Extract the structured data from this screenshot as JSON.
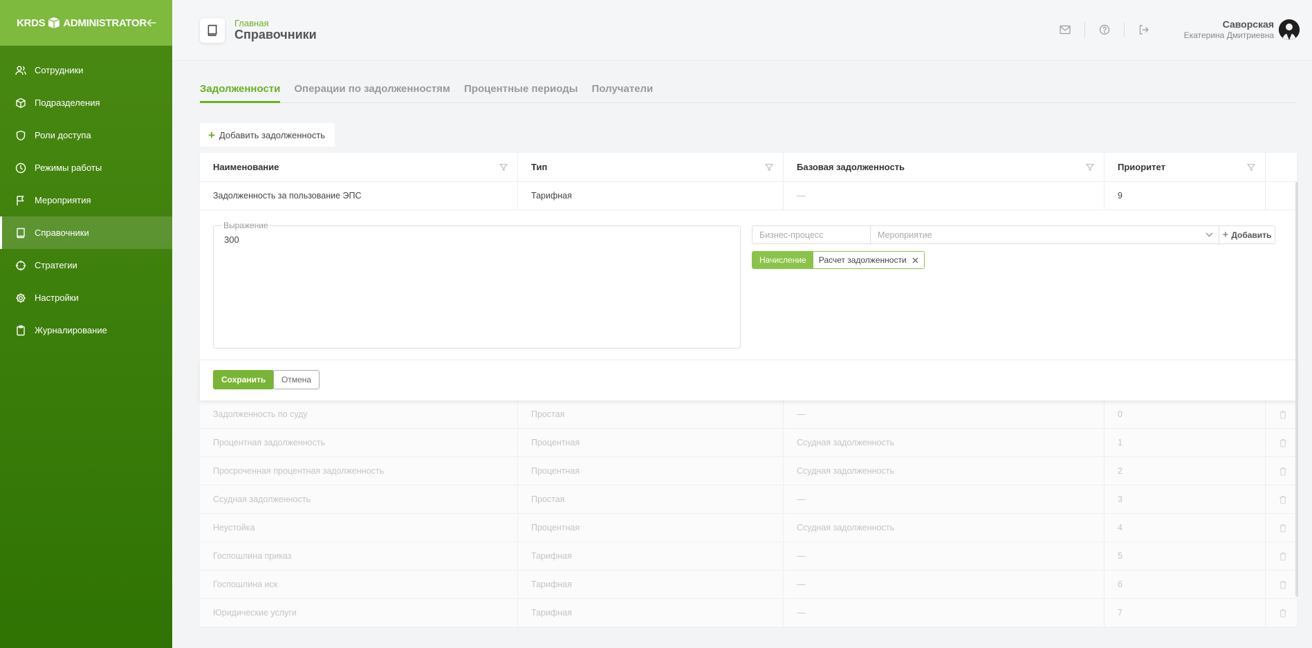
{
  "app": {
    "logo_left": "KRDS",
    "logo_right": "ADMINISTRATOR"
  },
  "sidebar": {
    "items": [
      {
        "label": "Сотрудники",
        "icon": "users-icon"
      },
      {
        "label": "Подразделения",
        "icon": "cube-icon"
      },
      {
        "label": "Роли доступа",
        "icon": "shield-icon"
      },
      {
        "label": "Режимы работы",
        "icon": "clock-icon"
      },
      {
        "label": "Мероприятия",
        "icon": "flag-icon"
      },
      {
        "label": "Справочники",
        "icon": "book-icon",
        "active": true
      },
      {
        "label": "Стратегии",
        "icon": "crosshair-icon"
      },
      {
        "label": "Настройки",
        "icon": "gear-icon"
      },
      {
        "label": "Журналирование",
        "icon": "clipboard-icon"
      }
    ]
  },
  "header": {
    "breadcrumb": "Главная",
    "title": "Справочники",
    "user_last": "Саворская",
    "user_first": "Екатерина Дмитриевна"
  },
  "tabs": [
    "Задолженности",
    "Операции по задолженностям",
    "Процентные периоды",
    "Получатели"
  ],
  "toolbar": {
    "add_label": "Добавить задолженность"
  },
  "table": {
    "columns": [
      "Наименование",
      "Тип",
      "Базовая задолженность",
      "Приоритет"
    ],
    "selected": {
      "name": "Задолженность за пользование ЭПС",
      "type": "Тарифная",
      "base": "—",
      "priority": "9"
    },
    "editor": {
      "expr_label": "Выражение",
      "expr_value": "300",
      "process_placeholder": "Бизнес-процесс",
      "event_placeholder": "Мероприятие",
      "add_label": "Добавить",
      "tag_type": "Начисление",
      "tag_name": "Расчет задолженности",
      "save_label": "Сохранить",
      "cancel_label": "Отмена"
    },
    "rows": [
      {
        "name": "Задолженность по суду",
        "type": "Простая",
        "base": "—",
        "priority": "0"
      },
      {
        "name": "Процентная задолженность",
        "type": "Процентная",
        "base": "Ссудная задолженность",
        "priority": "1"
      },
      {
        "name": "Просроченная процентная задолженность",
        "type": "Процентная",
        "base": "Ссудная задолженность",
        "priority": "2"
      },
      {
        "name": "Ссудная задолженность",
        "type": "Простая",
        "base": "—",
        "priority": "3"
      },
      {
        "name": "Неустойка",
        "type": "Процентная",
        "base": "Ссудная задолженность",
        "priority": "4"
      },
      {
        "name": "Госпошлина приказ",
        "type": "Тарифная",
        "base": "—",
        "priority": "5"
      },
      {
        "name": "Госпошлина иск",
        "type": "Тарифная",
        "base": "—",
        "priority": "6"
      },
      {
        "name": "Юридические услуги",
        "type": "Тарифная",
        "base": "—",
        "priority": "7"
      }
    ]
  },
  "colors": {
    "accent": "#6ab023",
    "sidebar": "#2f7304",
    "sidebar_head": "#7dba3d"
  }
}
